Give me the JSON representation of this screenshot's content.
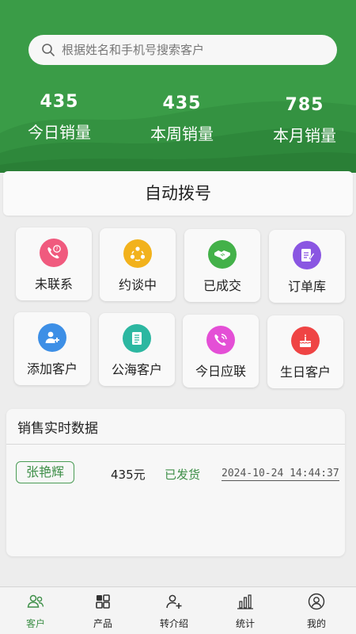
{
  "search": {
    "placeholder": "根据姓名和手机号搜索客户"
  },
  "stats": [
    {
      "value": "435",
      "label": "今日销量"
    },
    {
      "value": "435",
      "label": "本周销量"
    },
    {
      "value": "785",
      "label": "本月销量"
    }
  ],
  "autodial": {
    "label": "自动拨号"
  },
  "tiles": [
    {
      "label": "未联系",
      "icon": "phone-question-icon",
      "color": "#f05a7e"
    },
    {
      "label": "约谈中",
      "icon": "people-cycle-icon",
      "color": "#f2b21c"
    },
    {
      "label": "已成交",
      "icon": "handshake-icon",
      "color": "#43b149"
    },
    {
      "label": "订单库",
      "icon": "order-document-icon",
      "color": "#8a56e2"
    },
    {
      "label": "添加客户",
      "icon": "add-user-icon",
      "color": "#3d8fe6"
    },
    {
      "label": "公海客户",
      "icon": "document-list-icon",
      "color": "#2cb7a1"
    },
    {
      "label": "今日应联",
      "icon": "phone-call-icon",
      "color": "#e44fd6"
    },
    {
      "label": "生日客户",
      "icon": "birthday-cake-icon",
      "color": "#ef4444"
    }
  ],
  "sales_panel": {
    "title": "销售实时数据",
    "record": {
      "name": "张艳辉",
      "amount": "435元",
      "status": "已发货",
      "time": "2024-10-24 14:44:37"
    }
  },
  "tabbar": [
    {
      "label": "客户",
      "icon": "customers-icon",
      "active": true
    },
    {
      "label": "产品",
      "icon": "grid-icon",
      "active": false
    },
    {
      "label": "转介绍",
      "icon": "referral-icon",
      "active": false
    },
    {
      "label": "统计",
      "icon": "bar-chart-icon",
      "active": false
    },
    {
      "label": "我的",
      "icon": "profile-icon",
      "active": false
    }
  ],
  "colors": {
    "brand_green": "#3a9c47",
    "accent_text_green": "#3e8f48"
  }
}
